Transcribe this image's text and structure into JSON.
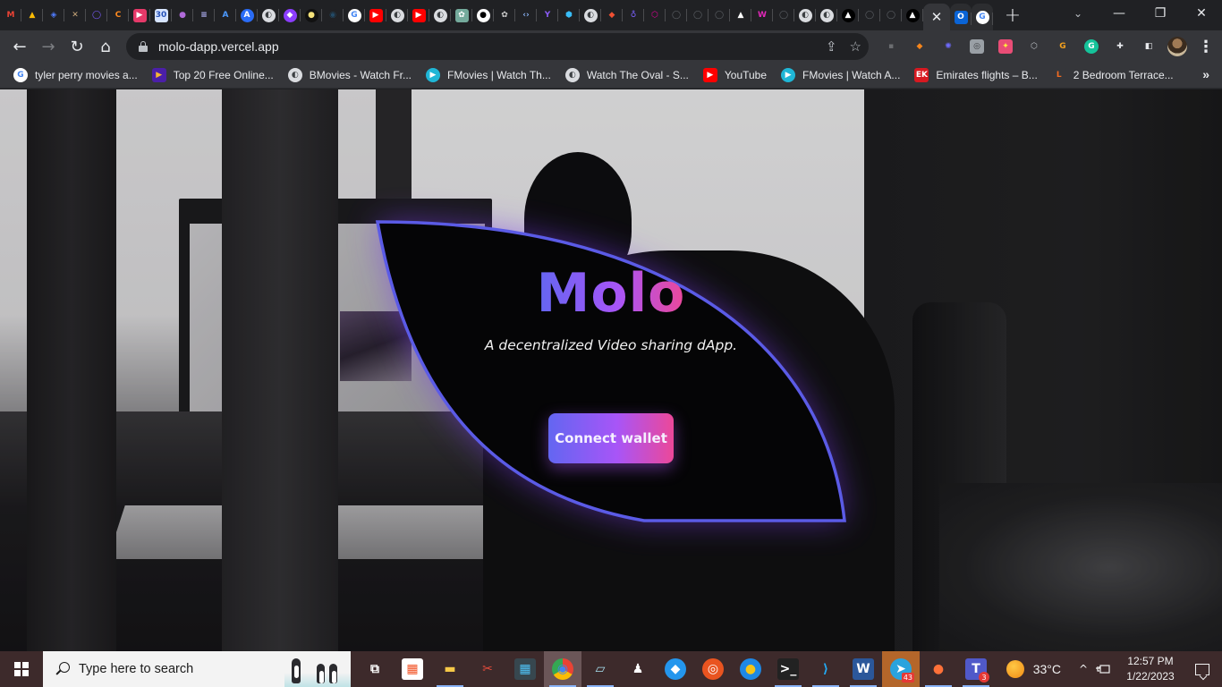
{
  "browser": {
    "pinned_tabs": [
      {
        "icon": "gmail-icon",
        "glyph": "M",
        "bg": "#202124",
        "fg": "#ea4335"
      },
      {
        "icon": "google-drive-icon",
        "glyph": "▲",
        "bg": "#202124",
        "fg": "#fbbc04"
      },
      {
        "icon": "diamond-app-icon",
        "glyph": "◈",
        "bg": "#202124",
        "fg": "#4f7cff"
      },
      {
        "icon": "tools-icon",
        "glyph": "✕",
        "bg": "#202124",
        "fg": "#c9a77a"
      },
      {
        "icon": "ring-app-icon",
        "glyph": "◯",
        "bg": "#202124",
        "fg": "#7b5cff"
      },
      {
        "icon": "orange-c-icon",
        "glyph": "C",
        "bg": "#202124",
        "fg": "#ff8a1f"
      },
      {
        "icon": "play-red-icon",
        "glyph": "▶",
        "bg": "#e53969",
        "fg": "#ffffff"
      },
      {
        "icon": "calendar-30-icon",
        "glyph": "30",
        "bg": "#d6e4ff",
        "fg": "#2451b7"
      },
      {
        "icon": "crystal-ball-icon",
        "glyph": "●",
        "bg": "#202124",
        "fg": "#b06ad9"
      },
      {
        "icon": "bars-app-icon",
        "glyph": "≡",
        "bg": "#202124",
        "fg": "#b8b8ff"
      },
      {
        "icon": "bracket-a-icon",
        "glyph": "A",
        "bg": "#202124",
        "fg": "#4c9aff"
      },
      {
        "icon": "arweave-a-icon",
        "glyph": "A",
        "bg": "#2a6cf6",
        "fg": "#ffffff"
      },
      {
        "icon": "globe-icon",
        "glyph": "◐",
        "bg": "#dadce0",
        "fg": "#3c4043"
      },
      {
        "icon": "purple-dot-icon",
        "glyph": "◆",
        "bg": "#8b3dff",
        "fg": "#ffffff"
      },
      {
        "icon": "yellow-dot-icon",
        "glyph": "●",
        "bg": "#111111",
        "fg": "#f5e27a"
      },
      {
        "icon": "dark-circle-icon",
        "glyph": "◉",
        "bg": "#202124",
        "fg": "#234a66"
      },
      {
        "icon": "google-icon",
        "glyph": "G",
        "bg": "#ffffff",
        "fg": "#4285f4"
      },
      {
        "icon": "youtube-icon",
        "glyph": "▶",
        "bg": "#ff0000",
        "fg": "#ffffff"
      },
      {
        "icon": "globe-icon",
        "glyph": "◐",
        "bg": "#dadce0",
        "fg": "#3c4043"
      },
      {
        "icon": "youtube-icon",
        "glyph": "▶",
        "bg": "#ff0000",
        "fg": "#ffffff"
      },
      {
        "icon": "globe-icon",
        "glyph": "◐",
        "bg": "#dadce0",
        "fg": "#3c4043"
      },
      {
        "icon": "chatgpt-icon",
        "glyph": "✿",
        "bg": "#74aa9c",
        "fg": "#ffffff"
      },
      {
        "icon": "medium-icon",
        "glyph": "●",
        "bg": "#ffffff",
        "fg": "#000000"
      },
      {
        "icon": "openai-icon",
        "glyph": "✿",
        "bg": "#202124",
        "fg": "#cfcfcf"
      },
      {
        "icon": "code-brackets-icon",
        "glyph": "‹›",
        "bg": "#202124",
        "fg": "#8ab4f8"
      },
      {
        "icon": "sprout-icon",
        "glyph": "Y",
        "bg": "#202124",
        "fg": "#8b5cf6"
      },
      {
        "icon": "hexagon-icon",
        "glyph": "⬢",
        "bg": "#202124",
        "fg": "#38bdf8"
      },
      {
        "icon": "globe-icon",
        "glyph": "◐",
        "bg": "#dadce0",
        "fg": "#3c4043"
      },
      {
        "icon": "git-icon",
        "glyph": "◆",
        "bg": "#202124",
        "fg": "#f05033"
      },
      {
        "icon": "location-pin-icon",
        "glyph": "♁",
        "bg": "#202124",
        "fg": "#7b61ff"
      },
      {
        "icon": "graphql-icon",
        "glyph": "⬡",
        "bg": "#202124",
        "fg": "#e10098"
      },
      {
        "icon": "github-icon",
        "glyph": "◯",
        "bg": "#202124",
        "fg": "#5f6368"
      },
      {
        "icon": "github-icon",
        "glyph": "◯",
        "bg": "#202124",
        "fg": "#5f6368"
      },
      {
        "icon": "github-icon",
        "glyph": "◯",
        "bg": "#202124",
        "fg": "#5f6368"
      },
      {
        "icon": "vercel-icon",
        "glyph": "▲",
        "bg": "#202124",
        "fg": "#ffffff"
      },
      {
        "icon": "w-logo-icon",
        "glyph": "W",
        "bg": "#202124",
        "fg": "#e028b8"
      },
      {
        "icon": "github-icon",
        "glyph": "◯",
        "bg": "#202124",
        "fg": "#5f6368"
      },
      {
        "icon": "globe-icon",
        "glyph": "◐",
        "bg": "#dadce0",
        "fg": "#3c4043"
      },
      {
        "icon": "globe-icon",
        "glyph": "◐",
        "bg": "#dadce0",
        "fg": "#3c4043"
      },
      {
        "icon": "vercel-icon",
        "glyph": "▲",
        "bg": "#000000",
        "fg": "#ffffff"
      },
      {
        "icon": "github-icon",
        "glyph": "◯",
        "bg": "#202124",
        "fg": "#5f6368"
      },
      {
        "icon": "github-icon",
        "glyph": "◯",
        "bg": "#202124",
        "fg": "#5f6368"
      },
      {
        "icon": "vercel-icon",
        "glyph": "▲",
        "bg": "#000000",
        "fg": "#ffffff"
      }
    ],
    "active_tab_close": "✕",
    "after_tabs": [
      {
        "icon": "outlook-icon",
        "glyph": "O",
        "bg": "#0a64d6",
        "fg": "#ffffff"
      },
      {
        "icon": "google-icon",
        "glyph": "G",
        "bg": "#ffffff",
        "fg": "#4285f4"
      }
    ],
    "new_tab": "+",
    "tab_search": "⌄",
    "window": {
      "minimize": "—",
      "restore": "❐",
      "close": "✕"
    },
    "nav": {
      "back": "←",
      "forward": "→",
      "reload": "↻",
      "home": "⌂"
    },
    "address": {
      "url": "molo-dapp.vercel.app"
    },
    "omnibox_actions": {
      "share": "⇪",
      "bookmark": "☆"
    },
    "extensions": [
      {
        "icon": "extension-grey-icon",
        "glyph": "▪",
        "bg": "#35363a",
        "fg": "#6b6d70"
      },
      {
        "icon": "metamask-icon",
        "glyph": "◆",
        "bg": "#35363a",
        "fg": "#f6851b"
      },
      {
        "icon": "burst-icon",
        "glyph": "✺",
        "bg": "#35363a",
        "fg": "#6f6bff"
      },
      {
        "icon": "camera-icon",
        "glyph": "◎",
        "bg": "#9aa0a6",
        "fg": "#35363a"
      },
      {
        "icon": "colorful-extension-icon",
        "glyph": "✦",
        "bg": "#e94d76",
        "fg": "#ffeb3b"
      },
      {
        "icon": "cube-icon",
        "glyph": "⬡",
        "bg": "#35363a",
        "fg": "#bdc1c6"
      },
      {
        "icon": "g-orange-icon",
        "glyph": "G",
        "bg": "#35363a",
        "fg": "#f4a11e"
      },
      {
        "icon": "grammarly-icon",
        "glyph": "G",
        "bg": "#15c39a",
        "fg": "#ffffff"
      },
      {
        "icon": "puzzle-icon",
        "glyph": "✚",
        "bg": "#35363a",
        "fg": "#e8eaed"
      },
      {
        "icon": "side-panel-icon",
        "glyph": "◧",
        "bg": "#35363a",
        "fg": "#e8eaed"
      }
    ],
    "menu": "⋮",
    "bookmarks": [
      {
        "icon": "google-icon",
        "glyph": "G",
        "bg": "#ffffff",
        "fg": "#4285f4",
        "label": "tyler perry movies a..."
      },
      {
        "icon": "play-purple-icon",
        "glyph": "▶",
        "bg": "#4b1fa8",
        "fg": "#f7b733",
        "label": "Top 20 Free Online..."
      },
      {
        "icon": "globe-icon",
        "glyph": "◐",
        "bg": "#dadce0",
        "fg": "#3c4043",
        "label": "BMovies - Watch Fr..."
      },
      {
        "icon": "fmovies-icon",
        "glyph": "▶",
        "bg": "#1fb6d6",
        "fg": "#ffffff",
        "label": "FMovies | Watch Th..."
      },
      {
        "icon": "globe-icon",
        "glyph": "◐",
        "bg": "#dadce0",
        "fg": "#3c4043",
        "label": "Watch The Oval - S..."
      },
      {
        "icon": "youtube-icon",
        "glyph": "▶",
        "bg": "#ff0000",
        "fg": "#ffffff",
        "label": "YouTube"
      },
      {
        "icon": "fmovies-icon",
        "glyph": "▶",
        "bg": "#1fb6d6",
        "fg": "#ffffff",
        "label": "FMovies | Watch A..."
      },
      {
        "icon": "emirates-icon",
        "glyph": "EK",
        "bg": "#d71921",
        "fg": "#ffffff",
        "label": "Emirates flights – B..."
      },
      {
        "icon": "l-letter-icon",
        "glyph": "L",
        "bg": "#35363a",
        "fg": "#f26b21",
        "label": "2 Bedroom Terrace..."
      }
    ],
    "bookmarks_more": "»"
  },
  "page": {
    "title": "Molo",
    "subtitle": "A decentralized Video sharing dApp.",
    "cta": "Connect wallet",
    "colors": {
      "accent_start": "#6366f1",
      "accent_mid": "#a855f7",
      "accent_end": "#ec4899",
      "card_border": "#5b5be6",
      "card_glow": "#7c3aed"
    }
  },
  "taskbar": {
    "search_placeholder": "Type here to search",
    "apps": [
      {
        "name": "task-view",
        "glyph": "⧉",
        "color": "#ffffff",
        "bg": "transparent",
        "state": ""
      },
      {
        "name": "microsoft-store",
        "glyph": "▦",
        "color": "#f25022",
        "bg": "#ffffff",
        "state": ""
      },
      {
        "name": "file-explorer",
        "glyph": "▬",
        "color": "#f7c948",
        "bg": "transparent",
        "state": "running"
      },
      {
        "name": "snipping-tool",
        "glyph": "✂",
        "color": "#e74c3c",
        "bg": "transparent",
        "state": ""
      },
      {
        "name": "calculator",
        "glyph": "▦",
        "color": "#4fc3f7",
        "bg": "#37474f",
        "state": ""
      },
      {
        "name": "chrome",
        "glyph": "◉",
        "color": "#4285f4",
        "bg": "transparent",
        "state": "active"
      },
      {
        "name": "notepad",
        "glyph": "▱",
        "color": "#a8e0f0",
        "bg": "transparent",
        "state": "running"
      },
      {
        "name": "linux-tux",
        "glyph": "♟",
        "color": "#ffffff",
        "bg": "transparent",
        "state": ""
      },
      {
        "name": "docker",
        "glyph": "◆",
        "color": "#ffffff",
        "bg": "#2496ed",
        "state": ""
      },
      {
        "name": "ubuntu",
        "glyph": "◎",
        "color": "#ffffff",
        "bg": "#e95420",
        "state": ""
      },
      {
        "name": "penguin-app",
        "glyph": "●",
        "color": "#f5c518",
        "bg": "#1e88e5",
        "state": ""
      },
      {
        "name": "terminal",
        "glyph": ">_",
        "color": "#ffffff",
        "bg": "#222222",
        "state": "running"
      },
      {
        "name": "vscode",
        "glyph": "⟩",
        "color": "#23a9f2",
        "bg": "transparent",
        "state": "running"
      },
      {
        "name": "word",
        "glyph": "W",
        "color": "#ffffff",
        "bg": "#2b579a",
        "state": "running"
      },
      {
        "name": "telegram",
        "glyph": "➤",
        "color": "#ffffff",
        "bg": "#2aa3dd",
        "state": "highlight",
        "badge": "43"
      },
      {
        "name": "firefox",
        "glyph": "●",
        "color": "#ff7139",
        "bg": "transparent",
        "state": "running"
      },
      {
        "name": "teams",
        "glyph": "T",
        "color": "#ffffff",
        "bg": "#5059c9",
        "state": "running",
        "badge": "3"
      }
    ],
    "weather": {
      "temp": "33°C"
    },
    "tray_chevron": "^",
    "clock": {
      "time": "12:57 PM",
      "date": "1/22/2023"
    }
  }
}
